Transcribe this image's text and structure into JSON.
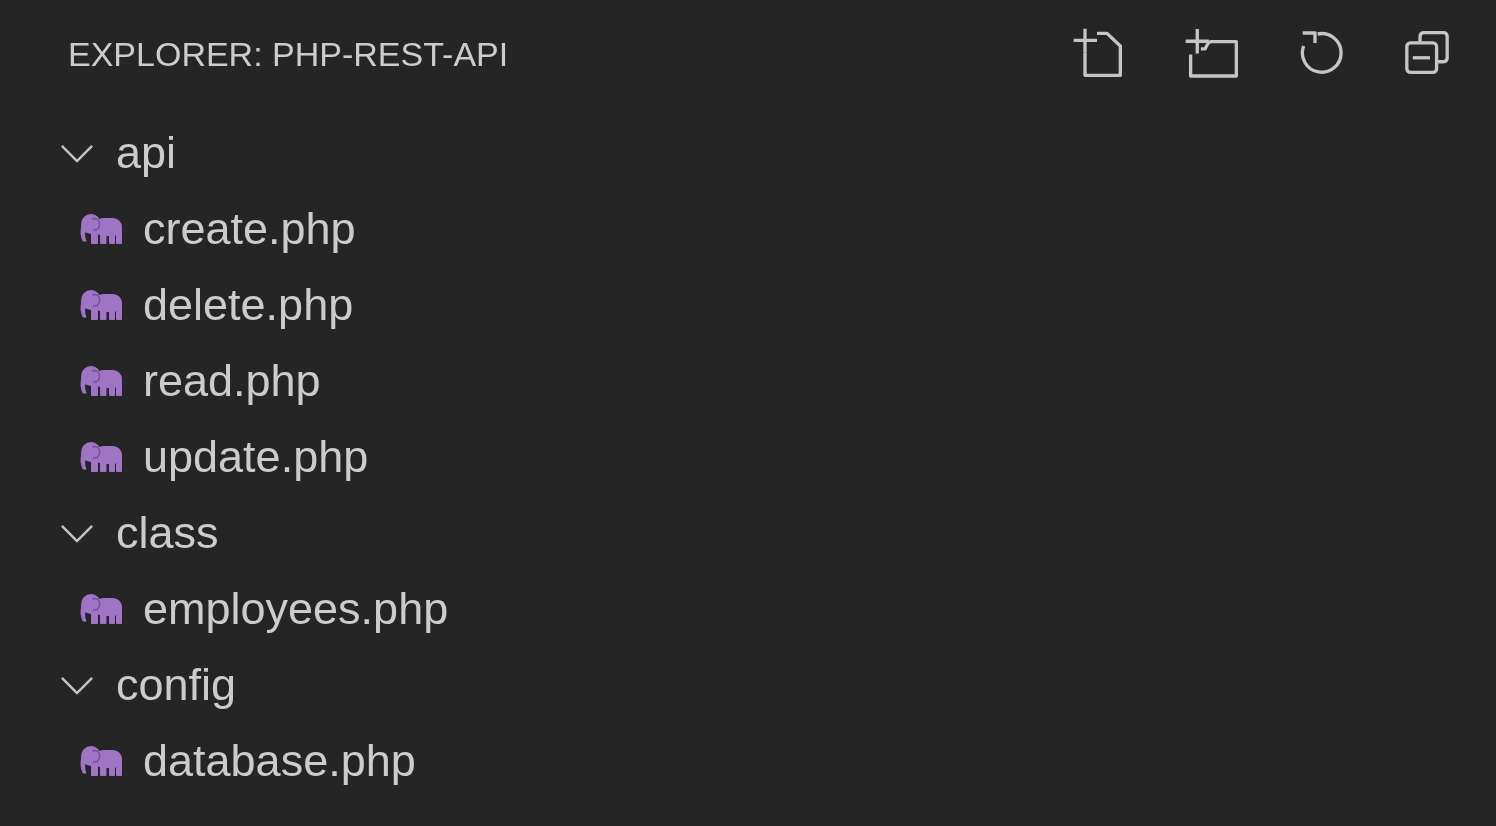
{
  "explorer": {
    "title": "EXPLORER: PHP-REST-API"
  },
  "tree": [
    {
      "kind": "folder",
      "label": "api",
      "expanded": true,
      "children": [
        {
          "kind": "file",
          "label": "create.php"
        },
        {
          "kind": "file",
          "label": "delete.php"
        },
        {
          "kind": "file",
          "label": "read.php"
        },
        {
          "kind": "file",
          "label": "update.php"
        }
      ]
    },
    {
      "kind": "folder",
      "label": "class",
      "expanded": true,
      "children": [
        {
          "kind": "file",
          "label": "employees.php"
        }
      ]
    },
    {
      "kind": "folder",
      "label": "config",
      "expanded": true,
      "children": [
        {
          "kind": "file",
          "label": "database.php"
        }
      ]
    }
  ]
}
